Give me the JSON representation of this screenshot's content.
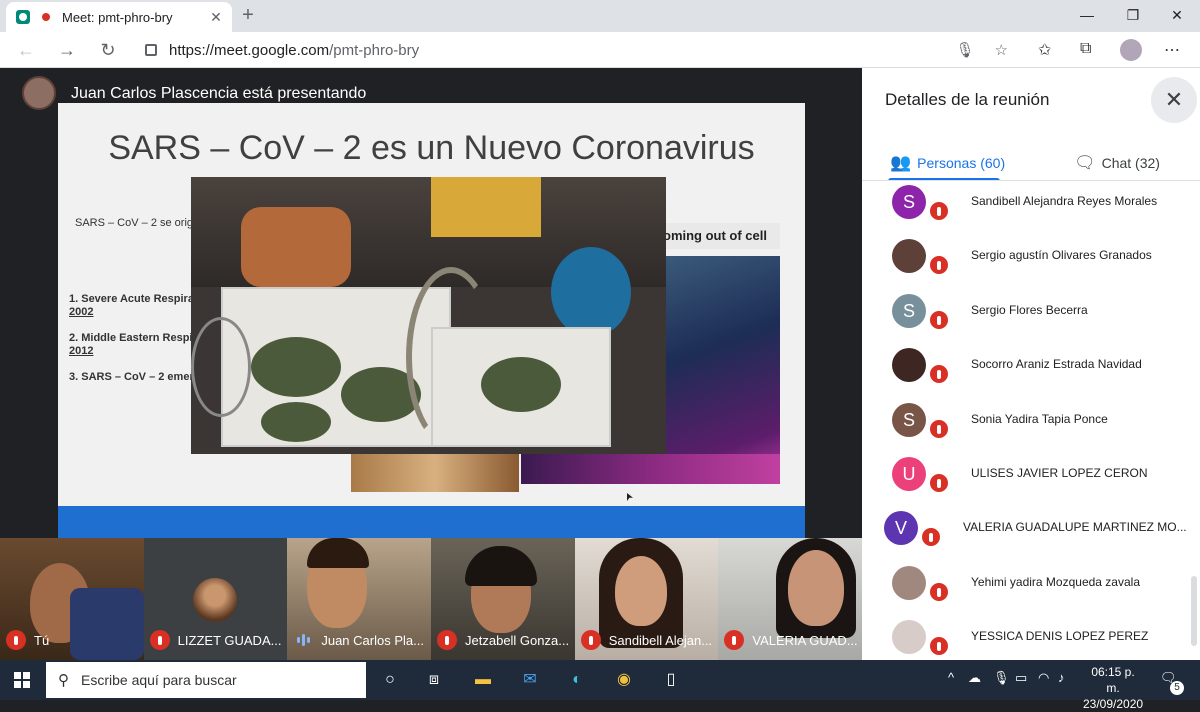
{
  "browser": {
    "tab_title": "Meet: pmt-phro-bry",
    "tab_close": "✕",
    "new_tab": "+",
    "url_host": "https://meet.google.com",
    "url_path": "/pmt-phro-bry"
  },
  "meet": {
    "presenting_label": "Juan Carlos Plascencia está presentando",
    "slide": {
      "title": "SARS – CoV – 2 es un Nuevo Coronavirus",
      "intro": "SARS – CoV – 2 se origi",
      "item1a": "1. Severe Acute Respira",
      "item1b": "2002",
      "item2a": "2. Middle Eastern Respi",
      "item2b": "2012",
      "item3": "3. SARS – CoV – 2 emer",
      "cell_label": "oming out of cell"
    },
    "thumbnails": [
      {
        "name": "Tú",
        "muted": true
      },
      {
        "name": "LIZZET GUADA...",
        "muted": true
      },
      {
        "name": "Juan Carlos Pla...",
        "muted": false
      },
      {
        "name": "Jetzabell Gonza...",
        "muted": true
      },
      {
        "name": "Sandibell Alejan...",
        "muted": true
      },
      {
        "name": "VALERIA GUAD...",
        "muted": true
      }
    ]
  },
  "panel": {
    "title": "Detalles de la reunión",
    "close": "✕",
    "tab_people": "Personas (60)",
    "tab_chat": "Chat (32)",
    "participants": [
      {
        "initial": "S",
        "name": "Sandibell Alejandra Reyes Morales",
        "color": "#8e24aa"
      },
      {
        "initial": "",
        "name": "Sergio agustín Olivares Granados",
        "color": "#5d4037"
      },
      {
        "initial": "S",
        "name": "Sergio Flores Becerra",
        "color": "#78909c"
      },
      {
        "initial": "",
        "name": "Socorro Araniz Estrada Navidad",
        "color": "#3e2723"
      },
      {
        "initial": "S",
        "name": "Sonia Yadira Tapia Ponce",
        "color": "#795548"
      },
      {
        "initial": "U",
        "name": "ULISES JAVIER LOPEZ CERON",
        "color": "#ec407a"
      },
      {
        "initial": "V",
        "name": "VALERIA GUADALUPE MARTINEZ MO...",
        "color": "#5e35b1"
      },
      {
        "initial": "",
        "name": "Yehimi yadira Mozqueda zavala",
        "color": "#a1887f"
      },
      {
        "initial": "",
        "name": "YESSICA DENIS LOPEZ PEREZ",
        "color": "#d7ccc8"
      }
    ]
  },
  "taskbar": {
    "search_placeholder": "Escribe aquí para buscar",
    "time": "06:15 p. m.",
    "date": "23/09/2020",
    "notifications": "5"
  }
}
